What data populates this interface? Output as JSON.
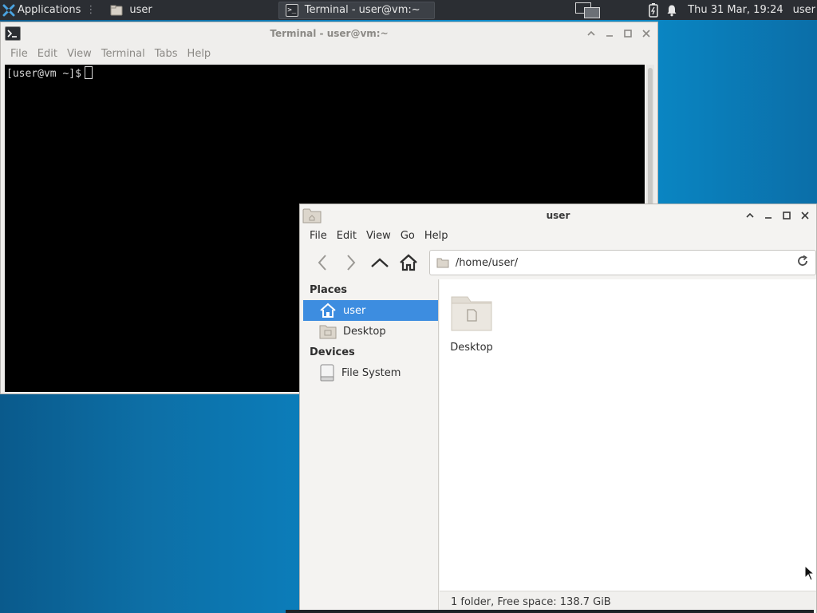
{
  "panel": {
    "applications_label": "Applications",
    "separator": "⋮",
    "task_user_label": "user",
    "task_terminal_label": "Terminal - user@vm:~",
    "clock": "Thu 31 Mar, 19:24",
    "user_label": "user"
  },
  "terminal": {
    "title": "Terminal - user@vm:~",
    "menu": [
      "File",
      "Edit",
      "View",
      "Terminal",
      "Tabs",
      "Help"
    ],
    "prompt": "[user@vm ~]$"
  },
  "filemanager": {
    "title": "user",
    "menu": [
      "File",
      "Edit",
      "View",
      "Go",
      "Help"
    ],
    "location": "/home/user/",
    "places_heading": "Places",
    "places": [
      "user",
      "Desktop"
    ],
    "devices_heading": "Devices",
    "devices": [
      "File System"
    ],
    "files": [
      "Desktop"
    ],
    "status": "1 folder, Free space: 138.7 GiB"
  },
  "colors": {
    "panel_bg": "#2b2e33",
    "selection": "#3d8de0",
    "terminal_bg": "#000000"
  }
}
